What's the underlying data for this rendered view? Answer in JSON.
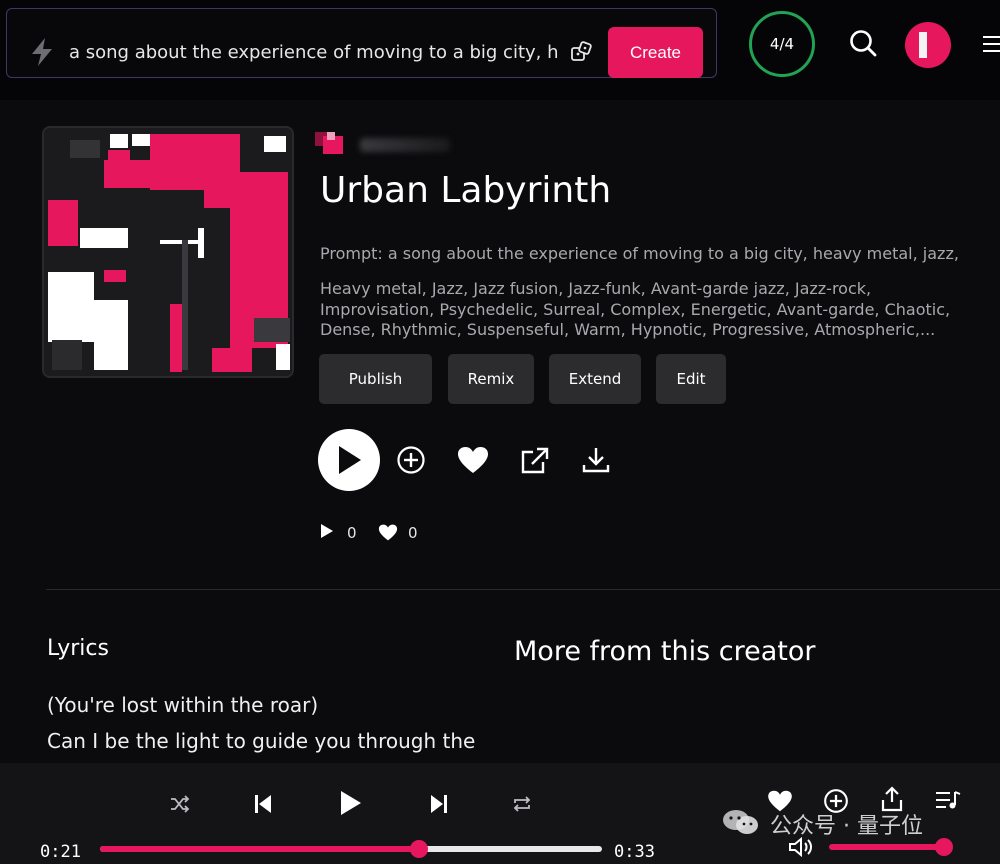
{
  "header": {
    "prompt_text": "a song about the experience of moving to a big city, h",
    "create_label": "Create",
    "credits": "4/4"
  },
  "song": {
    "title": "Urban Labyrinth",
    "prompt": "Prompt: a song about the experience of moving to a big city, heavy metal, jazz,",
    "tags_lines": [
      "Heavy metal, Jazz, Jazz fusion, Jazz-funk, Avant-garde jazz, Jazz-rock,",
      "Improvisation, Psychedelic, Surreal, Complex, Energetic, Avant-garde, Chaotic,",
      "Dense, Rhythmic, Suspenseful, Warm, Hypnotic, Progressive, Atmospheric,..."
    ],
    "actions": [
      "Publish",
      "Remix",
      "Extend",
      "Edit"
    ],
    "play_count": "0",
    "like_count": "0"
  },
  "sections": {
    "lyrics_heading": "Lyrics",
    "more_heading": "More from this creator",
    "lyrics": [
      "(You're lost within the roar)",
      "Can I be the light to guide you through the"
    ]
  },
  "player": {
    "elapsed": "0:21",
    "duration": "0:33",
    "progress_fraction": 0.636,
    "volume_fraction": 0.92
  },
  "watermark": "公众号 · 量子位",
  "colors": {
    "accent": "#e6175c",
    "credits_ring": "#21a354",
    "background": "#0b0b0d",
    "button_bg": "#2c2c2f"
  },
  "icons": {
    "prompt_mode": "lightning-bolt-icon",
    "randomize": "dice-icon",
    "search": "search-icon",
    "menu": "hamburger-menu-icon",
    "play": "play-icon",
    "add": "plus-circle-icon",
    "like": "heart-icon",
    "share": "external-link-icon",
    "download": "download-icon",
    "shuffle": "shuffle-icon",
    "previous": "skip-previous-icon",
    "next": "skip-next-icon",
    "repeat": "repeat-icon",
    "queue": "playlist-icon",
    "volume": "volume-icon"
  }
}
